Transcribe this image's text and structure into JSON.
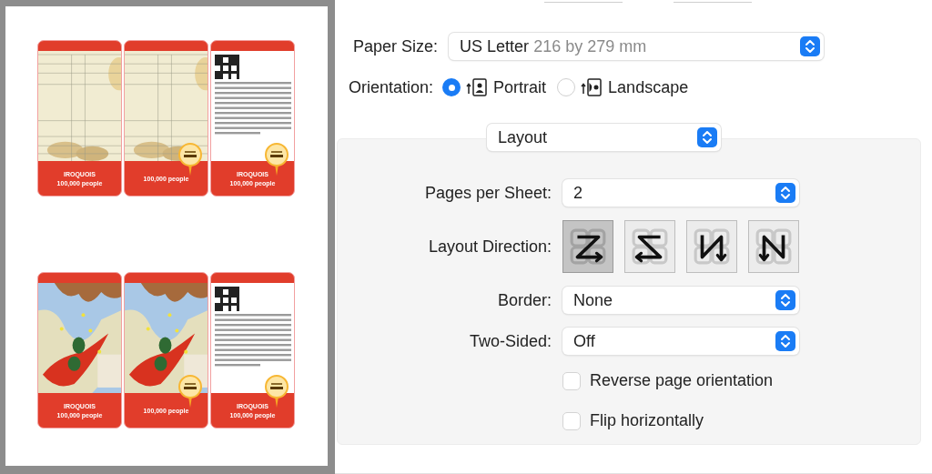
{
  "preview": {
    "sheets": [
      {
        "cards": [
          {
            "kind": "table",
            "title": "IROQUOIS",
            "subtitle": "100,000 people",
            "badge": false
          },
          {
            "kind": "table",
            "subtitle": "100,000 people",
            "badge": true
          },
          {
            "kind": "text",
            "title": "IROQUOIS",
            "subtitle": "100,000 people",
            "badge": true
          }
        ]
      },
      {
        "cards": [
          {
            "kind": "map",
            "title": "IROQUOIS",
            "subtitle": "100,000 people",
            "badge": false
          },
          {
            "kind": "map",
            "subtitle": "100,000 people",
            "badge": true
          },
          {
            "kind": "text",
            "title": "IROQUOIS",
            "subtitle": "100,000 people",
            "badge": true
          }
        ]
      }
    ]
  },
  "paper_size": {
    "label": "Paper Size:",
    "value": "US Letter",
    "detail": "216 by 279 mm"
  },
  "orientation": {
    "label": "Orientation:",
    "options": [
      {
        "kind": "portrait",
        "label": "Portrait",
        "selected": true
      },
      {
        "kind": "landscape",
        "label": "Landscape",
        "selected": false
      }
    ]
  },
  "section": {
    "value": "Layout"
  },
  "pages_per_sheet": {
    "label": "Pages per Sheet:",
    "value": "2"
  },
  "layout_direction": {
    "label": "Layout Direction:",
    "options": [
      {
        "kind": "z",
        "selected": true
      },
      {
        "kind": "reverse_z",
        "selected": false
      },
      {
        "kind": "reverse_n",
        "selected": false
      },
      {
        "kind": "n",
        "selected": false
      }
    ]
  },
  "border": {
    "label": "Border:",
    "value": "None"
  },
  "two_sided": {
    "label": "Two-Sided:",
    "value": "Off"
  },
  "checkboxes": [
    {
      "label": "Reverse page orientation",
      "checked": false
    },
    {
      "label": "Flip horizontally",
      "checked": false
    }
  ]
}
